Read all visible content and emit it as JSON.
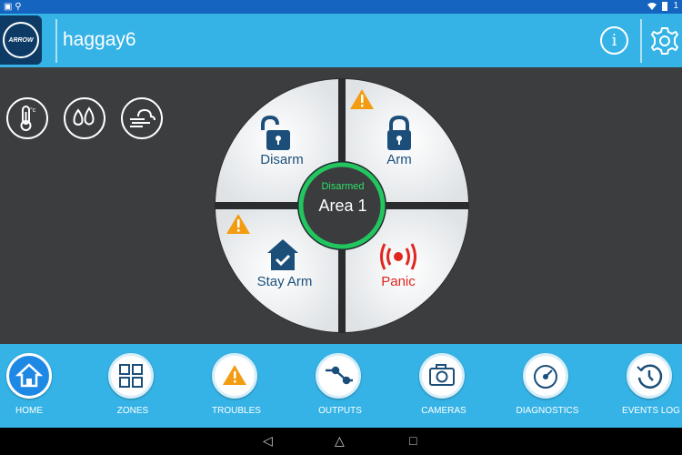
{
  "status_bar": {
    "left_icons": "▣ ⚲",
    "time": "1"
  },
  "header": {
    "logo_text": "ARROW",
    "title": "haggay6",
    "info_symbol": "i"
  },
  "environment_icons": [
    "thermometer-icon",
    "humidity-icon",
    "weather-icon"
  ],
  "thermo_unit": "°c",
  "wheel": {
    "disarm_label": "Disarm",
    "arm_label": "Arm",
    "stay_arm_label": "Stay Arm",
    "panic_label": "Panic",
    "center_status": "Disarmed",
    "center_area": "Area 1"
  },
  "colors": {
    "header_blue": "#35b3e6",
    "label_blue": "#1b4f7a",
    "panic_red": "#e0261e",
    "ring_green": "#22c55e",
    "warning_orange": "#f39c12"
  },
  "nav": {
    "items": [
      {
        "label": "HOME",
        "icon": "home-icon",
        "active": true
      },
      {
        "label": "ZONES",
        "icon": "zones-grid-icon",
        "active": false
      },
      {
        "label": "TROUBLES",
        "icon": "warning-icon",
        "active": false
      },
      {
        "label": "OUTPUTS",
        "icon": "outputs-switch-icon",
        "active": false
      },
      {
        "label": "CAMERAS",
        "icon": "camera-icon",
        "active": false
      },
      {
        "label": "DIAGNOSTICS",
        "icon": "gauge-icon",
        "active": false
      },
      {
        "label": "EVENTS LOG",
        "icon": "history-icon",
        "active": false
      }
    ]
  },
  "system_nav": {
    "back": "◁",
    "home": "△",
    "recents": "□"
  }
}
